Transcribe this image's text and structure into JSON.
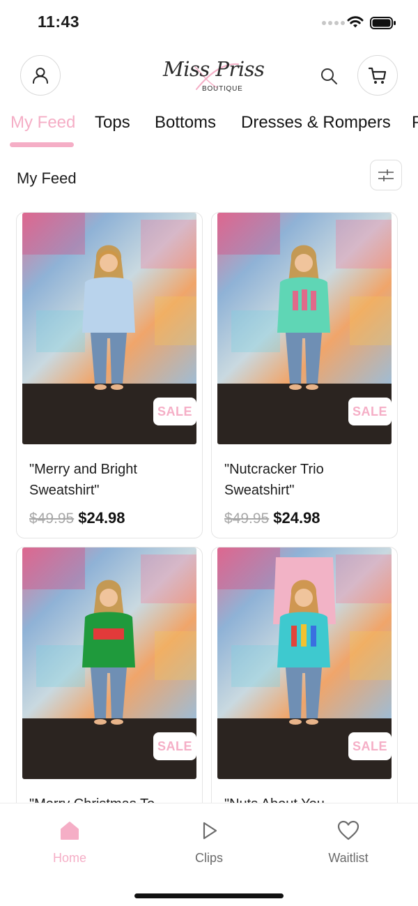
{
  "status_bar": {
    "time": "11:43"
  },
  "header": {
    "logo_script": "Miss Priss",
    "logo_sub": "BOUTIQUE"
  },
  "tabs": [
    {
      "label": "My Feed",
      "active": true
    },
    {
      "label": "Tops"
    },
    {
      "label": "Bottoms"
    },
    {
      "label": "Dresses & Rompers"
    },
    {
      "label": "P"
    }
  ],
  "feed": {
    "title": "My Feed"
  },
  "products": [
    {
      "name": "\"Merry and Bright Sweatshirt\"",
      "old_price": "$49.95",
      "price": "$24.98",
      "badge": "SALE",
      "sweater_color": "#b9d3ec"
    },
    {
      "name": "\"Nutcracker Trio Sweatshirt\"",
      "old_price": "$49.95",
      "price": "$24.98",
      "badge": "SALE",
      "sweater_color": "#5fd6b5"
    },
    {
      "name": "\"Merry Christmas To",
      "badge": "SALE",
      "sweater_color": "#1f9a3c"
    },
    {
      "name": "\"Nuts About You",
      "badge": "SALE",
      "sweater_color": "#3ec9cf"
    }
  ],
  "bottom_nav": [
    {
      "label": "Home",
      "icon": "home-icon",
      "active": true
    },
    {
      "label": "Clips",
      "icon": "play-icon"
    },
    {
      "label": "Waitlist",
      "icon": "heart-icon"
    }
  ],
  "colors": {
    "accent": "#f5aec6",
    "text": "#1c1c1c",
    "muted": "#a8a8a8",
    "divider": "#e0e2e5"
  }
}
